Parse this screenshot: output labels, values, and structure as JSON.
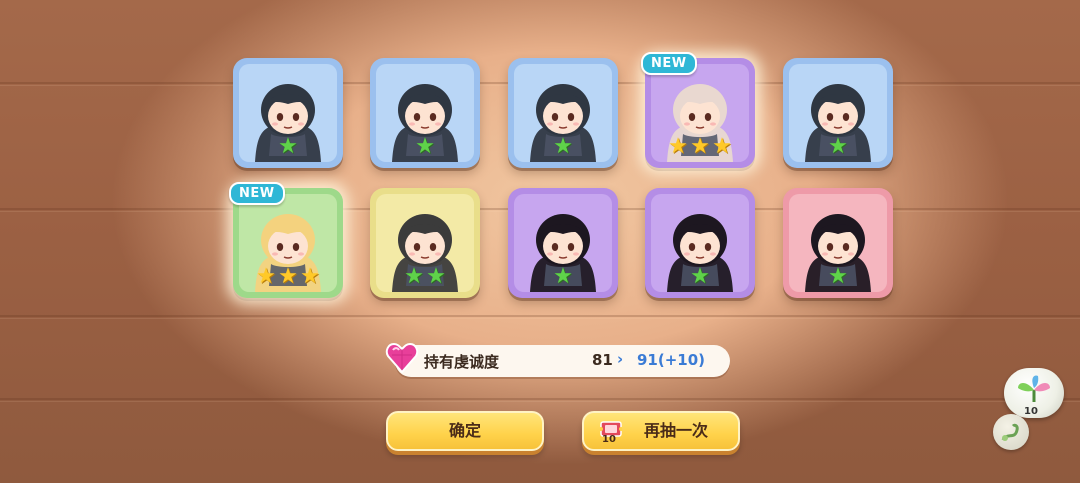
{
  "cards": [
    {
      "frame": "blue",
      "hair": "#2f3742",
      "stars": 1,
      "star_color": "green",
      "is_new": false
    },
    {
      "frame": "blue",
      "hair": "#2f3742",
      "stars": 1,
      "star_color": "green",
      "is_new": false
    },
    {
      "frame": "blue",
      "hair": "#2f3742",
      "stars": 1,
      "star_color": "green",
      "is_new": false
    },
    {
      "frame": "purple",
      "hair": "#e9d8d0",
      "stars": 3,
      "star_color": "yellow",
      "is_new": true
    },
    {
      "frame": "blue",
      "hair": "#2f3742",
      "stars": 1,
      "star_color": "green",
      "is_new": false
    },
    {
      "frame": "green",
      "hair": "#f4d27e",
      "stars": 3,
      "star_color": "yellow",
      "is_new": true
    },
    {
      "frame": "yellow",
      "hair": "#3b3b3b",
      "stars": 2,
      "star_color": "green",
      "is_new": false
    },
    {
      "frame": "purple",
      "hair": "#1d1720",
      "stars": 1,
      "star_color": "green",
      "is_new": false
    },
    {
      "frame": "purple",
      "hair": "#1d1720",
      "stars": 1,
      "star_color": "green",
      "is_new": false
    },
    {
      "frame": "pink",
      "hair": "#1d1720",
      "stars": 1,
      "star_color": "green",
      "is_new": false
    }
  ],
  "new_badge_label": "NEW",
  "loyalty": {
    "label": "持有虔诚度",
    "from_value": "81",
    "arrow": "›",
    "to_value": "91(+10)"
  },
  "buttons": {
    "confirm_label": "确定",
    "again_label": "再抽一次",
    "again_ticket_count": "10"
  },
  "side_badge": {
    "icon": "sprout-icon",
    "count": "10",
    "secondary_icon": "vine-icon"
  },
  "colors": {
    "accent_blue": "#3a7bd5",
    "button_yellow": "#ffd24a",
    "new_badge": "#2fb7d6"
  }
}
